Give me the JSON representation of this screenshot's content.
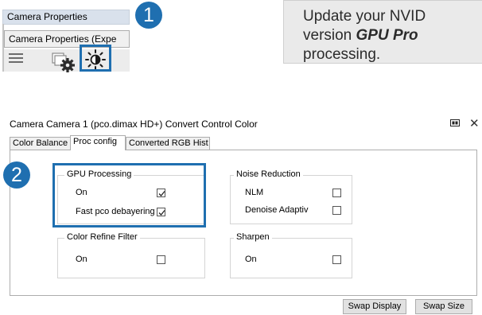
{
  "camera_properties": {
    "title": "Camera Properties",
    "tab_label": "Camera Properties (Expe",
    "icons": [
      "menu-icon",
      "gear-icon",
      "brightness-icon"
    ]
  },
  "badges": {
    "one": "1",
    "two": "2"
  },
  "tip": {
    "line1": "Update your NVID",
    "line2_prefix": "version ",
    "line2_emphasis": "GPU Pro",
    "line3": "processing."
  },
  "window": {
    "title": "Camera Camera 1 (pco.dimax HD+) Convert Control Color",
    "tabs": [
      {
        "label": "Color Balance",
        "active": false
      },
      {
        "label": "Proc config",
        "active": true
      },
      {
        "label": "Converted RGB Hist",
        "active": false
      }
    ],
    "groups": {
      "gpu": {
        "label": "GPU Processing",
        "rows": [
          {
            "label": "On",
            "checked": true
          },
          {
            "label": "Fast pco debayering",
            "checked": true
          }
        ]
      },
      "noise": {
        "label": "Noise Reduction",
        "rows": [
          {
            "label": "NLM",
            "checked": false
          },
          {
            "label": "Denoise Adaptiv",
            "checked": false
          }
        ]
      },
      "color_refine": {
        "label": "Color Refine Filter",
        "rows": [
          {
            "label": "On",
            "checked": false
          }
        ]
      },
      "sharpen": {
        "label": "Sharpen",
        "rows": [
          {
            "label": "On",
            "checked": false
          }
        ]
      }
    },
    "buttons": {
      "swap_display": "Swap Display",
      "swap_size": "Swap Size"
    }
  },
  "colors": {
    "accent": "#1f6fb0",
    "panel_header": "#d9e1ec",
    "tip_background": "#eaeaea"
  }
}
